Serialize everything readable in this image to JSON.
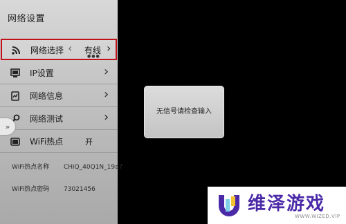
{
  "sidebar": {
    "title": "网络设置",
    "items": [
      {
        "label": "网络选择",
        "icon": "wifi-icon",
        "value": "有线",
        "selected": true
      },
      {
        "label": "IP设置",
        "icon": "monitor-icon",
        "value": "",
        "selected": false
      },
      {
        "label": "网络信息",
        "icon": "document-icon",
        "value": "",
        "selected": false
      },
      {
        "label": "网络测试",
        "icon": "wrench-icon",
        "value": "",
        "selected": false
      },
      {
        "label": "WiFi热点",
        "icon": "hotspot-icon",
        "value": "开",
        "selected": false
      }
    ],
    "hotspot_name_label": "WiFi热点名称",
    "hotspot_name_value": "CHiQ_40Q1N_19a7",
    "hotspot_password_label": "WiFi热点密码",
    "hotspot_password_value": "73021456"
  },
  "dialog": {
    "message": "无信号请检查输入"
  },
  "watermark": {
    "name": "维泽游戏",
    "sub": "WWW.WIZED.VIP"
  },
  "colors": {
    "highlight": "#c1121b",
    "brand": "#4b2aa8"
  }
}
